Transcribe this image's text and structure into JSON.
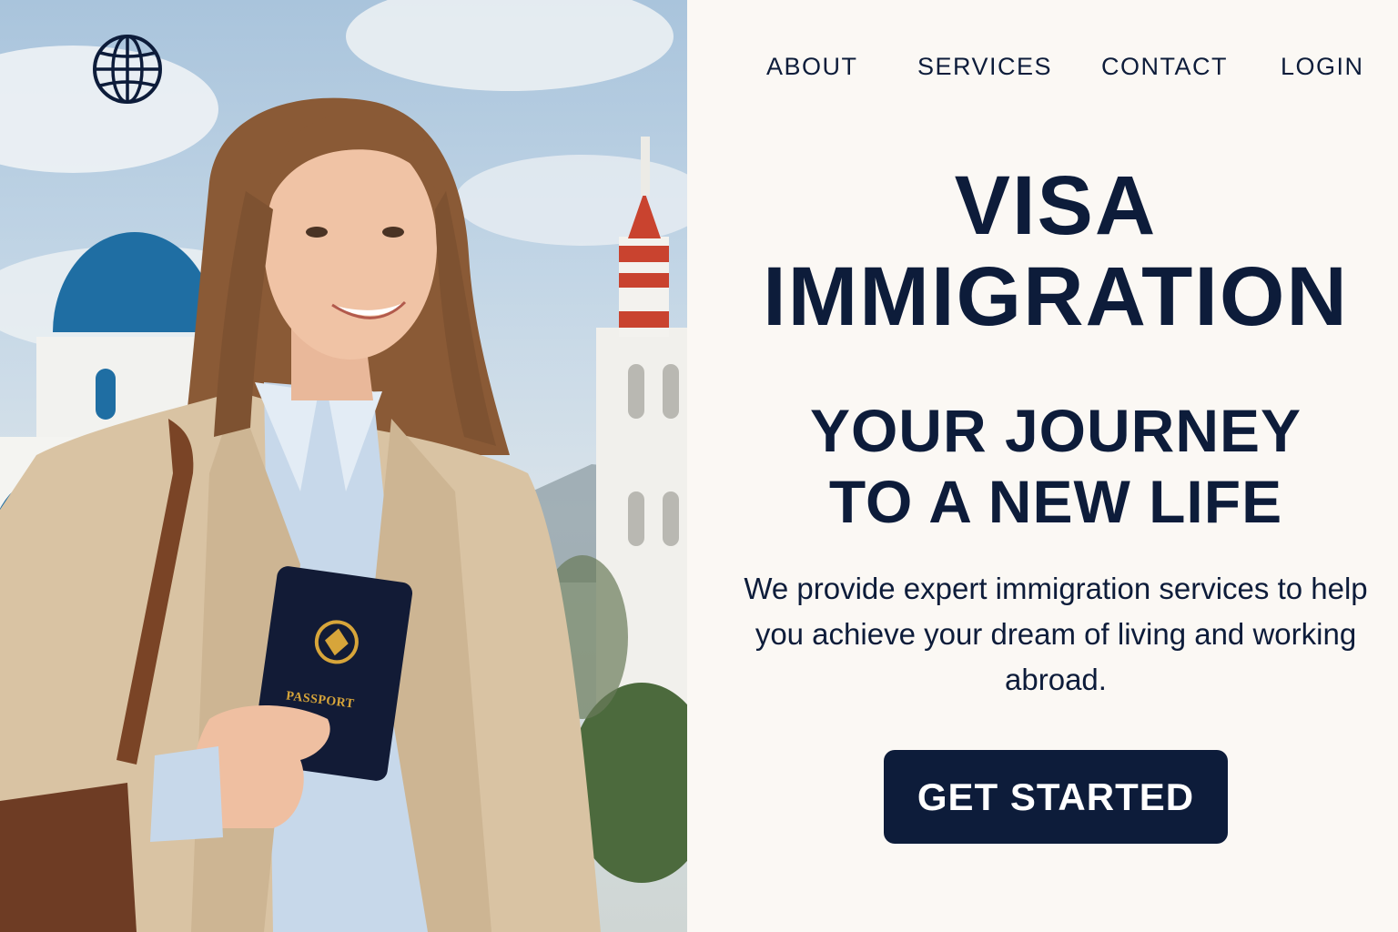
{
  "brand": {
    "logo_icon": "globe-icon"
  },
  "nav": {
    "items": [
      {
        "label": "ABOUT"
      },
      {
        "label": "SERVICES"
      },
      {
        "label": "CONTACT"
      },
      {
        "label": "LOGIN"
      }
    ]
  },
  "hero": {
    "title_lines": [
      "VISA",
      "IMMIGRATION"
    ],
    "subtitle_lines": [
      "YOUR JOURNEY",
      "TO A NEW LIFE"
    ],
    "description": "We provide expert immigration services to help you achieve your dream of living and working abroad.",
    "cta_label": "GET STARTED",
    "passport_text": "PASSPORT"
  },
  "colors": {
    "primary": "#0d1c3a",
    "background": "#fbf8f4",
    "dome_blue": "#1f6ea3",
    "tower_red": "#c9432f",
    "passport_gold": "#d7a53a"
  }
}
